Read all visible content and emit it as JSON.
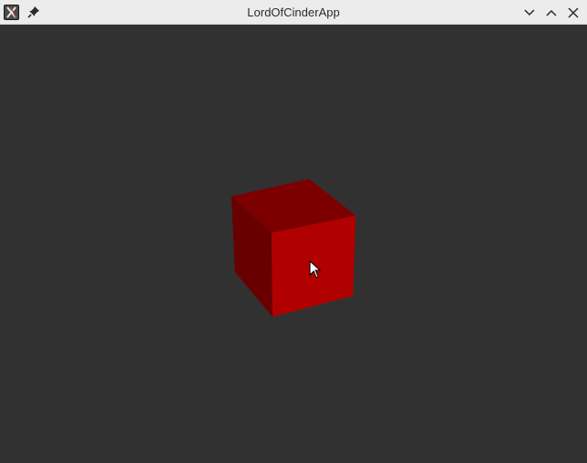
{
  "window": {
    "title": "LordOfCinderApp"
  },
  "titlebar": {
    "app_icon": "x-app-icon",
    "pin_icon": "pin-icon",
    "controls": [
      "minimize-icon",
      "maximize-icon",
      "close-icon"
    ]
  },
  "viewport": {
    "background": "#313131",
    "object": "red-cube",
    "cube_colors": {
      "top": "#7c0000",
      "left": "#690000",
      "front": "#b00000"
    }
  }
}
